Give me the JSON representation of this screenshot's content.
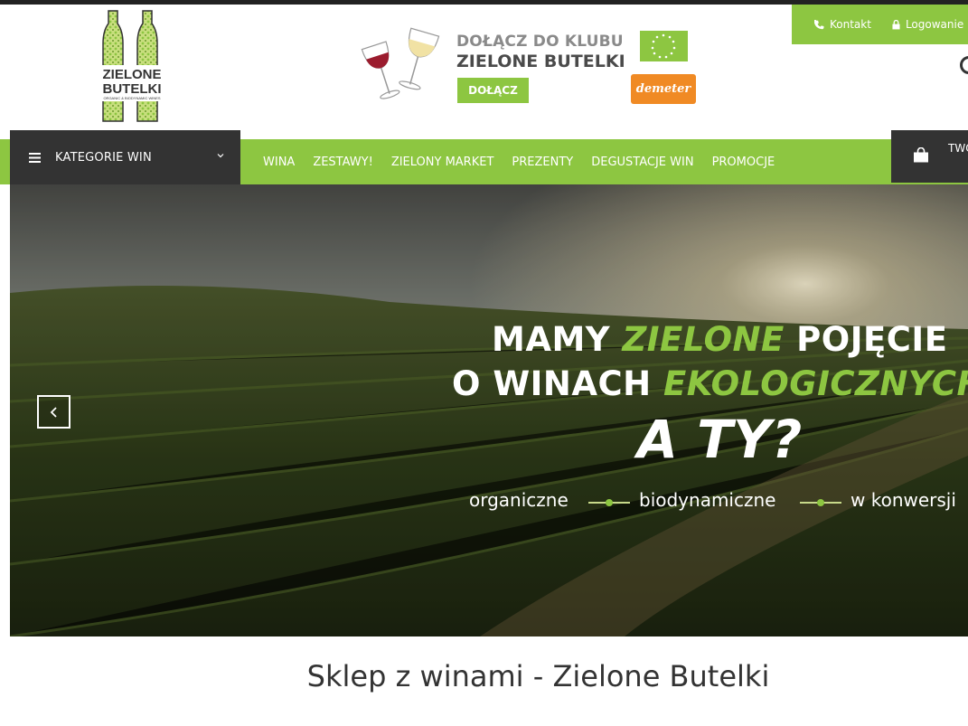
{
  "logo": {
    "line1": "ZIELONE",
    "line2": "BUTELKI",
    "tagline": "ORGANIC & BIODYNAMIC WINES"
  },
  "banner": {
    "title1": "DOŁĄCZ DO KLUBU",
    "title2": "ZIELONE BUTELKI",
    "button": "DOŁĄCZ",
    "cert": "demeter"
  },
  "account": {
    "contact": "Kontakt",
    "login": "Logowanie"
  },
  "categories": {
    "label": "KATEGORIE WIN"
  },
  "nav": {
    "items": [
      "WINA",
      "ZESTAWY!",
      "ZIELONY MARKET",
      "PREZENTY",
      "DEGUSTACJE WIN",
      "PROMOCJE"
    ]
  },
  "cart": {
    "label": "TWÓJ"
  },
  "hero": {
    "line1_a": "MAMY ",
    "line1_b": "ZIELONE",
    "line1_c": " POJĘCIE",
    "line2_a": "O WINACH ",
    "line2_b": "EKOLOGICZNYCH",
    "line3": "A TY?",
    "sub1": "organiczne",
    "sub2": "biodynamiczne",
    "sub3": "w konwersji"
  },
  "page": {
    "title": "Sklep z winami - Zielone Butelki"
  },
  "colors": {
    "accent": "#8dc641",
    "dark": "#333333"
  }
}
